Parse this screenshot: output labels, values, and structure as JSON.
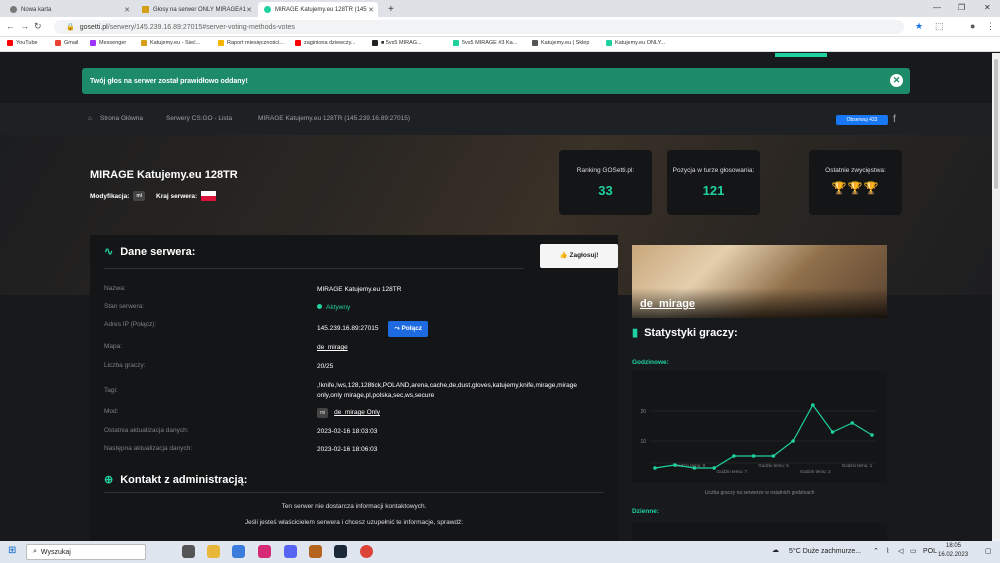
{
  "browser": {
    "tabs": [
      {
        "title": "Nowa karta"
      },
      {
        "title": "Głosy na serwer ONLY MIRAGE#1"
      },
      {
        "title": "MIRAGE Katujemy.eu 128TR (145"
      }
    ],
    "new_tab": "+",
    "url_host": "gosetti.pl",
    "url_path": "/serwery/145.239.16.89:27015#server-voting-methods-votes",
    "bookmarks": [
      {
        "label": "YouTube",
        "color": "#ff0000"
      },
      {
        "label": "Gmail",
        "color": "#ea4335"
      },
      {
        "label": "Messenger",
        "color": "#a033ff"
      },
      {
        "label": "Katujemy.eu - Sieć...",
        "color": "#d4a017"
      },
      {
        "label": "Raport miesięczności...",
        "color": "#f4b400"
      },
      {
        "label": "zaginiona dziewczy...",
        "color": "#ff0000"
      },
      {
        "label": "■ 5vs5 MIRAG...",
        "color": "#222222"
      },
      {
        "label": "5vs5 MIRAGE #3 Ka...",
        "color": "#1fd1a1"
      },
      {
        "label": "Katujemy.eu | Sklep",
        "color": "#555555"
      },
      {
        "label": "Katujemy.eu ONLY...",
        "color": "#1fd1a1"
      }
    ]
  },
  "alert": {
    "text": "Twój głos na serwer został prawidłowo oddany!",
    "close": "✕"
  },
  "breadcrumb": {
    "home": "Strona Główna",
    "list": "Serwery CS:GO - Lista",
    "current": "MIRAGE Katujemy.eu 128TR (145.239.16.89:27015)",
    "fb_follow": "Obserwuj 433"
  },
  "server": {
    "title": "MIRAGE Katujemy.eu 128TR",
    "mod_label": "Modyfikacja:",
    "mod_badge": "mi",
    "country_label": "Kraj serwera:"
  },
  "stats_boxes": [
    {
      "label": "Ranking GOSetti.pl:",
      "value": "33"
    },
    {
      "label": "Pozycja w turze głosowania:",
      "value": "121"
    },
    {
      "label": "Ostatnie zwycięstwa:",
      "value": "🏆🏆🏆"
    }
  ],
  "panel": {
    "title": "Dane serwera:",
    "vote_button": "Zagłosuj!",
    "rows": [
      {
        "key": "Nazwa:",
        "value": "MIRAGE Katujemy.eu 128TR"
      },
      {
        "key": "Stan serwera:",
        "value": "Aktywny"
      },
      {
        "key": "Adres IP (Połącz):",
        "value": "145.239.16.89:27015",
        "button": "Połącz"
      },
      {
        "key": "Mapa:",
        "value": "de_mirage"
      },
      {
        "key": "Liczba graczy:",
        "value": "20/25"
      },
      {
        "key": "Tagi:",
        "value": ",!knife,!ws,128,128tick,POLAND,arena,cache,de,dust,gloves,katujemy,knife,mirage,mirage only,only mirage,pl,polska,sec,ws,secure"
      },
      {
        "key": "Mod:",
        "value": "de_mirage Only",
        "badge": "mi"
      },
      {
        "key": "Ostatnia aktualizacja danych:",
        "value": "2023-02-16 18:03:03"
      },
      {
        "key": "Następna aktualizacja danych:",
        "value": "2023-02-16 18:06:03"
      }
    ],
    "contact_title": "Kontakt z administracją:",
    "contact_line1": "Ten serwer nie dostarcza informacji kontaktowych.",
    "contact_line2": "Jeśli jesteś właścicielem serwera i chcesz uzupełnić te informacje, sprawdź:"
  },
  "sidebar": {
    "map_name": "de_mirage",
    "stats_title": "Statystyki graczy:",
    "hourly_label": "Godzinowe:",
    "daily_label": "Dzienne:",
    "chart_caption": "Liczba graczy na serwerze w ostatnich godzinach"
  },
  "chart_data": {
    "type": "line",
    "title": "",
    "xlabel": "",
    "ylabel": "",
    "y_ticks": [
      "10",
      "20"
    ],
    "x_tick_labels": [
      "Godzin temu: 9",
      "Godzin temu: 7",
      "Godzin temu: 5",
      "Godzin temu: 3",
      "Godzin temu: 1"
    ],
    "ylim": [
      0,
      30
    ],
    "series": [
      {
        "values": [
          1,
          2,
          1,
          1,
          5,
          5,
          5,
          10,
          22,
          13,
          16,
          12
        ]
      }
    ],
    "color": "#1fd1a1"
  },
  "taskbar": {
    "search": "Wyszukaj",
    "weather": "5°C  Duże zachmurze...",
    "lang": "POL",
    "time": "18:05",
    "date": "16.02.2023"
  }
}
